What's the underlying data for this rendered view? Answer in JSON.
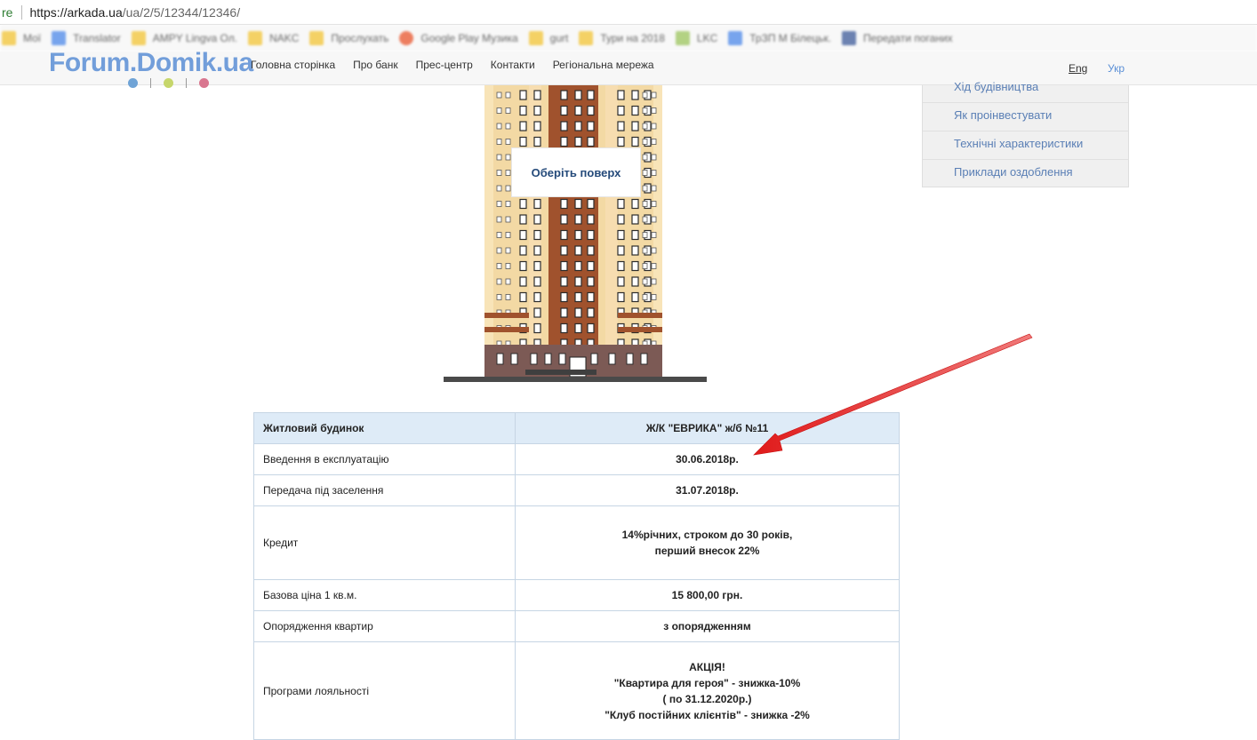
{
  "browser": {
    "secure_label": "re",
    "url_host": "https://arkada.ua",
    "url_path": "/ua/2/5/12344/12346/",
    "bookmarks": [
      "Мої",
      "Translator",
      "AMPY Lingva Ол.",
      "NAKC",
      "Прослухать",
      "Google Play Музика",
      "gurt",
      "Тури на 2018",
      "LKC",
      "ТрЗП М Білецьк.",
      "Передати поганих"
    ]
  },
  "site": {
    "logo": "Forum.Domik.ua",
    "logo_dot_colors": [
      "#6fa3d6",
      "#c6d66b",
      "#d9768f"
    ],
    "nav": [
      "Головна сторінка",
      "Про банк",
      "Прес-центр",
      "Контакти",
      "Регіональна мережа"
    ],
    "lang_eng": "Eng",
    "lang_ukr": "Укр"
  },
  "side_menu": {
    "items": [
      "Хід будівництва",
      "Як проінвестувати",
      "Технічні характеристики",
      "Приклади оздоблення"
    ]
  },
  "building": {
    "choose_floor": "Оберіть поверх"
  },
  "table": {
    "header": {
      "label": "Житловий будинок",
      "value": "Ж/К \"ЕВРИКА\" ж/б №11"
    },
    "rows": [
      {
        "label": "Введення в експлуатацію",
        "value": [
          "30.06.2018р."
        ]
      },
      {
        "label": "Передача під заселення",
        "value": [
          "31.07.2018р."
        ]
      },
      {
        "label": "Кредит",
        "value": [
          "14%річних, строком до 30 років,",
          "перший внесок 22%"
        ]
      },
      {
        "label": "Базова ціна 1 кв.м.",
        "value": [
          "15 800,00 грн."
        ]
      },
      {
        "label": "Опорядження квартир",
        "value": [
          "з опорядженням"
        ]
      },
      {
        "label": "Програми лояльності",
        "value": [
          "АКЦІЯ!",
          "\"Квартира для героя\" - знижка-10%",
          "( по 31.12.2020р.)",
          "\"Клуб постійних клієнтів\" - знижка -2%"
        ]
      }
    ]
  },
  "colors": {
    "accent": "#5b8fd6",
    "table_border": "#c6d5e4",
    "table_header_bg": "#deebf7",
    "arrow": "#e01b1b",
    "brick": "#a0522d",
    "facade": "#f3d9a4"
  }
}
